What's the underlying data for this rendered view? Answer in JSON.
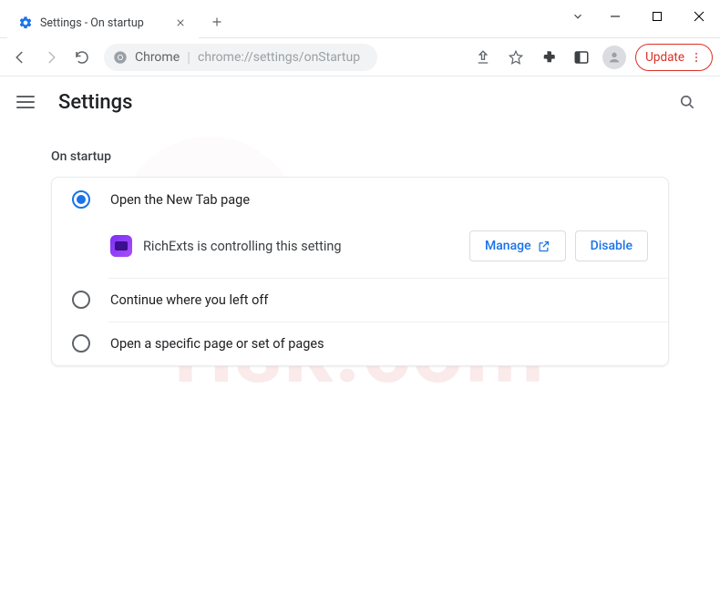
{
  "tab": {
    "title": "Settings - On startup"
  },
  "omnibox": {
    "chip": "Chrome",
    "path": "chrome://settings/onStartup"
  },
  "toolbar": {
    "update_label": "Update"
  },
  "header": {
    "title": "Settings"
  },
  "section": {
    "label": "On startup",
    "options": [
      {
        "label": "Open the New Tab page",
        "selected": true
      },
      {
        "label": "Continue where you left off",
        "selected": false
      },
      {
        "label": "Open a specific page or set of pages",
        "selected": false
      }
    ],
    "notice": {
      "extension_name": "RichExts",
      "text": "RichExts is controlling this setting",
      "manage": "Manage",
      "disable": "Disable"
    }
  }
}
